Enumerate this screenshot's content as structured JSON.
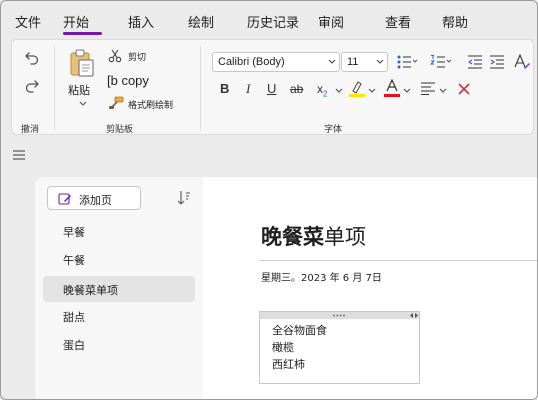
{
  "menu": {
    "tabs": [
      {
        "label": "文件"
      },
      {
        "label": "开始"
      },
      {
        "label": "插入"
      },
      {
        "label": "绘制"
      },
      {
        "label": "历史记录"
      },
      {
        "label": "审阅"
      },
      {
        "label": "查看"
      },
      {
        "label": "帮助"
      }
    ],
    "active_tab": "开始",
    "accent_color": "#7719aa"
  },
  "ribbon": {
    "undo_group": {
      "label": "撤消",
      "icons": [
        "undo-icon",
        "redo-icon"
      ]
    },
    "clipboard": {
      "label": "剪贴板",
      "paste_label": "粘贴",
      "cut_label": "剪切",
      "copy_label": "[b copy",
      "format_painter_label": "格式刷绘制"
    },
    "font": {
      "label": "字体",
      "font_name": "Calibri (Body)",
      "font_size": "11",
      "highlight_color": "#ffe600",
      "font_color": "#e81123",
      "buttons": [
        "bold-icon",
        "italic-icon",
        "underline-icon",
        "strikethrough-icon",
        "subscript-icon",
        "highlight-icon",
        "font-color-icon",
        "align-icon",
        "clear-formatting-icon"
      ],
      "list_buttons": [
        "bullets-icon",
        "numbering-icon",
        "decrease-indent-icon",
        "increase-indent-icon",
        "styles-icon"
      ]
    }
  },
  "pages": {
    "add_page_label": "添加页",
    "items": [
      {
        "label": "早餐"
      },
      {
        "label": "午餐"
      },
      {
        "label": "晚餐菜单项"
      },
      {
        "label": "甜点"
      },
      {
        "label": "蛋白"
      }
    ],
    "selected": "晚餐菜单项"
  },
  "page": {
    "title_bold": "晚餐菜",
    "title_rest": "单项",
    "date": "星期三。2023 年 6 月 7日",
    "note_lines": [
      "全谷物面食",
      "橄榄",
      "西红柿"
    ]
  }
}
